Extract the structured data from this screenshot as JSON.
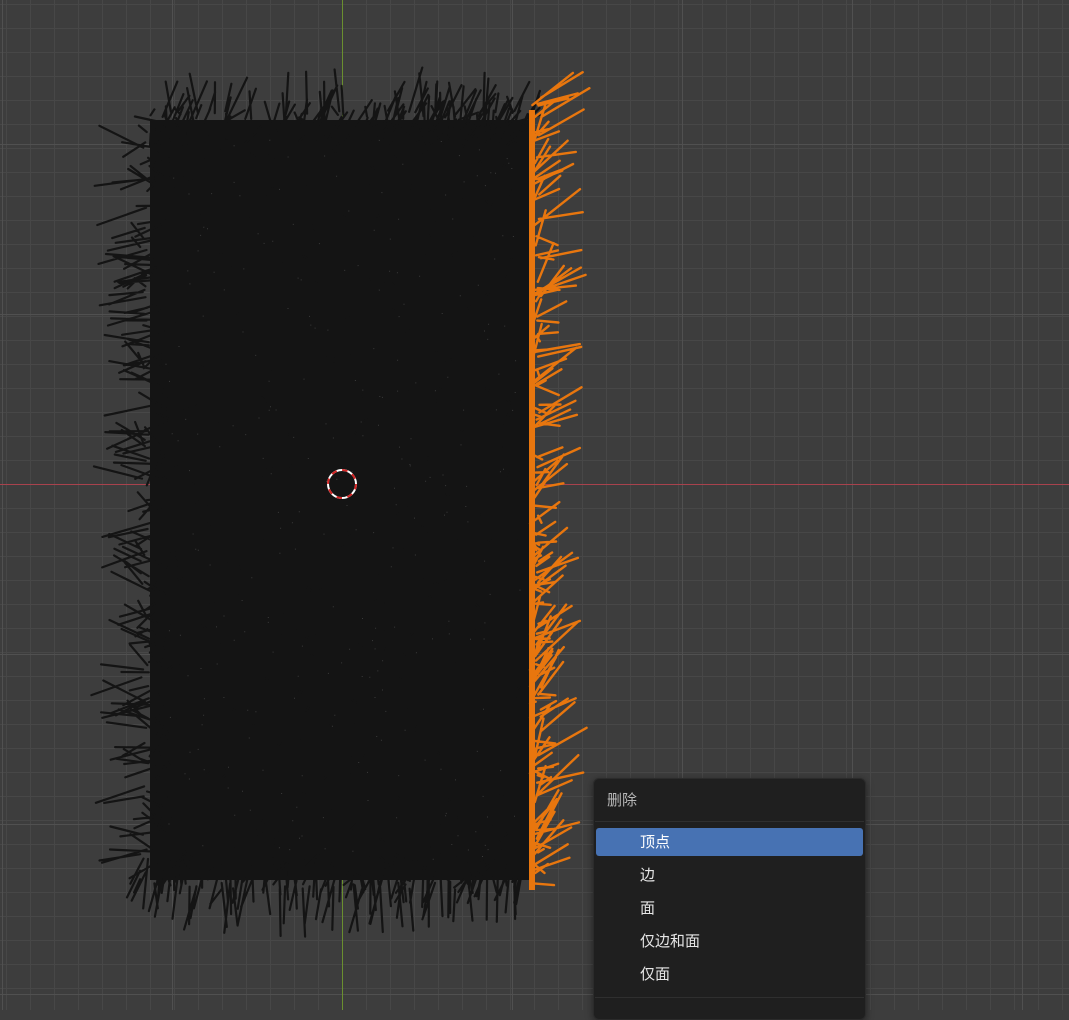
{
  "viewport": {
    "background_color": "#3d3d3d",
    "grid_color": "#4a4a4a",
    "x_axis_color": "#a8424d",
    "y_axis_color": "#6a8f2f",
    "object_color": "#141414",
    "selected_color": "#e8760e"
  },
  "context_menu": {
    "title": "删除",
    "items": [
      {
        "label": "顶点",
        "active": true
      },
      {
        "label": "边",
        "active": false
      },
      {
        "label": "面",
        "active": false
      },
      {
        "label": "仅边和面",
        "active": false
      },
      {
        "label": "仅面",
        "active": false
      }
    ],
    "active_color": "#4772b3"
  }
}
